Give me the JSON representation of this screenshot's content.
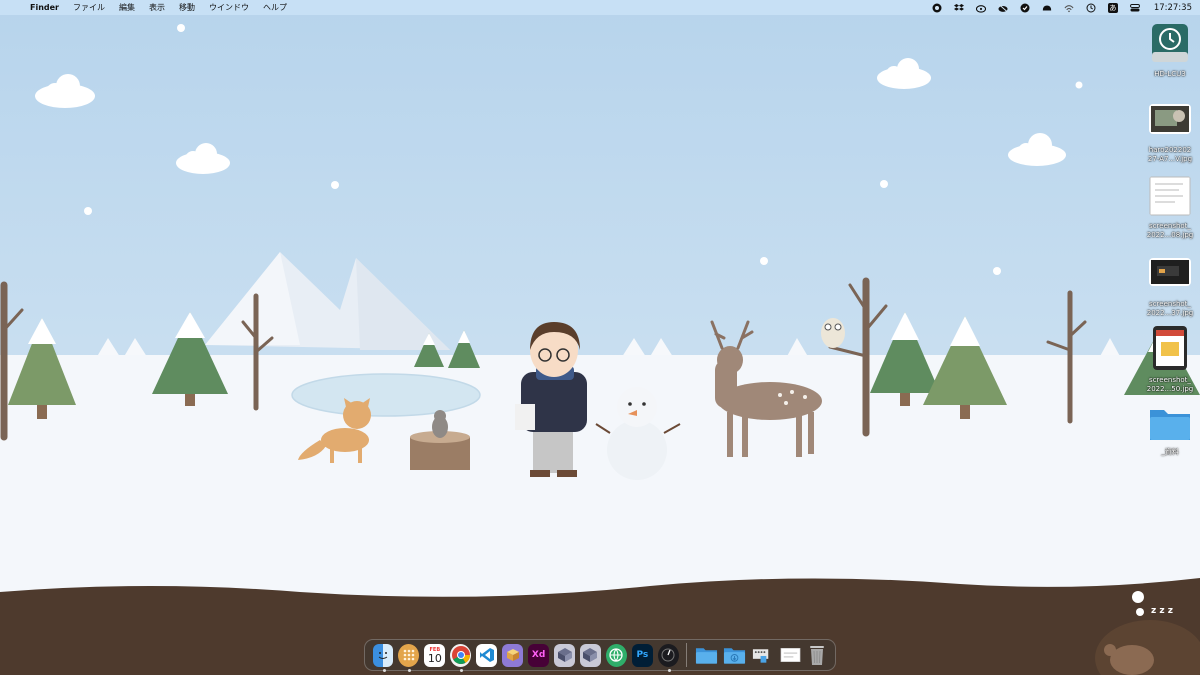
{
  "menubar": {
    "app_name": "Finder",
    "menus": [
      "ファイル",
      "編集",
      "表示",
      "移動",
      "ウインドウ",
      "ヘルプ"
    ],
    "status_icons": [
      "creative-cloud-icon",
      "dropbox-icon",
      "cloud-sync-icon",
      "cloud-mute-icon",
      "shield-icon",
      "hat-icon",
      "wifi-icon",
      "time-machine-icon",
      "input-method-icon",
      "control-center-icon"
    ],
    "input_method": "あ",
    "clock": "17:27:35"
  },
  "desktop": {
    "items": [
      {
        "label": "HD-LCU3",
        "kind": "drive"
      },
      {
        "label": "haro202202\n27-A7...V.jpg",
        "kind": "image"
      },
      {
        "label": "screenshot_\n2022...08.jpg",
        "kind": "image"
      },
      {
        "label": "screenshot_\n2022...37.jpg",
        "kind": "image"
      },
      {
        "label": "screenshot_\n2022...50.jpg",
        "kind": "image"
      },
      {
        "label": "_資料",
        "kind": "folder"
      }
    ]
  },
  "dock": {
    "calendar_day": "10",
    "calendar_month": "FEB",
    "xd_label": "Xd",
    "ps_label": "Ps",
    "apps": [
      "finder",
      "launchpad",
      "calendar",
      "chrome",
      "vscode",
      "box",
      "adobe-xd",
      "app-a",
      "app-b",
      "browser",
      "photoshop",
      "instruments"
    ]
  },
  "sleep_text": "z z z",
  "colors": {
    "sky": "#bcd9ef",
    "snow": "#f4f7fb",
    "ground": "#4e3a2d",
    "tree": "#5f8c5f",
    "folder": "#4aa3e6",
    "dock_bg": "#3c3732"
  }
}
